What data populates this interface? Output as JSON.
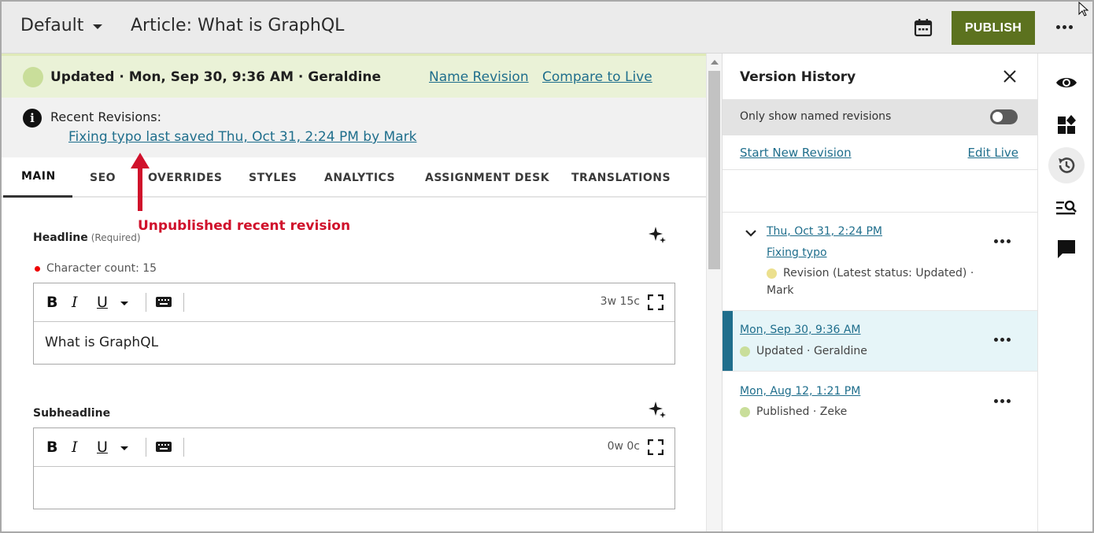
{
  "topbar": {
    "site_selector": "Default",
    "title": "Article: What is GraphQL",
    "publish_label": "PUBLISH",
    "publish_color": "#5c721f"
  },
  "status": {
    "text": "Updated · Mon, Sep 30, 9:36 AM · Geraldine",
    "name_revision": "Name Revision",
    "compare_live": "Compare to Live",
    "status_color": "#c9de9a"
  },
  "recent": {
    "label": "Recent Revisions:",
    "link": "Fixing typo last saved Thu, Oct 31, 2:24 PM by Mark"
  },
  "tabs": [
    "MAIN",
    "SEO",
    "OVERRIDES",
    "STYLES",
    "ANALYTICS",
    "ASSIGNMENT DESK",
    "TRANSLATIONS"
  ],
  "annotation": {
    "text": "Unpublished recent revision",
    "color": "#d0112b"
  },
  "fields": {
    "headline": {
      "label": "Headline",
      "required": "(Required)",
      "char_count": "Character count: 15",
      "word_count": "3w 15c",
      "value": "What is GraphQL"
    },
    "subheadline": {
      "label": "Subheadline",
      "word_count": "0w 0c",
      "value": ""
    },
    "toolbar": {
      "bold": "B",
      "italic": "I",
      "underline": "U"
    }
  },
  "version_history": {
    "title": "Version History",
    "toggle_label": "Only show named revisions",
    "toggle_on": false,
    "start_new": "Start New Revision",
    "edit_live": "Edit Live",
    "revisions": [
      {
        "date": "Thu, Oct 31, 2:24 PM",
        "name": "Fixing typo",
        "status": "Revision (Latest status: Updated) ·",
        "author": "Mark",
        "dot_color": "#ece08e"
      },
      {
        "date": "Mon, Sep 30, 9:36 AM",
        "status": "Updated · Geraldine",
        "dot_color": "#c9de9a",
        "selected": true
      },
      {
        "date": "Mon, Aug 12, 1:21 PM",
        "status": "Published · Zeke",
        "dot_color": "#c9de9a"
      }
    ]
  },
  "rail": [
    "eye-icon",
    "widgets-icon",
    "history-icon",
    "search-list-icon",
    "comment-icon"
  ]
}
